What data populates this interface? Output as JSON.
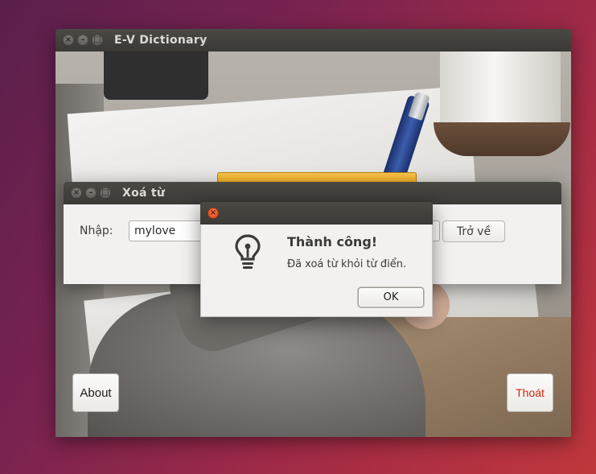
{
  "main_window": {
    "title": "E-V Dictionary",
    "about_label": "About",
    "exit_label": "Thoát"
  },
  "delete_window": {
    "title": "Xoá từ",
    "input_label": "Nhập:",
    "input_value": "mylove",
    "back_label": "Trở về"
  },
  "message_dialog": {
    "icon": "lightbulb-icon",
    "title": "Thành công!",
    "message": "Đã xoá từ khỏi từ điển.",
    "ok_label": "OK"
  },
  "colors": {
    "titlebar": "#3e3d39",
    "dialog_bg": "#f2f1f0",
    "close_button": "#e2531f",
    "exit_text": "#d32a0e"
  },
  "icons": {
    "close": "close-icon",
    "minimize": "minimize-icon",
    "maximize": "maximize-icon"
  }
}
